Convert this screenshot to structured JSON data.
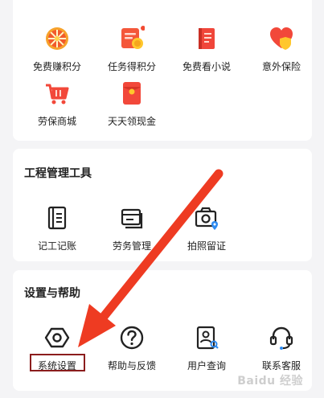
{
  "sections": [
    {
      "title": "",
      "items": [
        {
          "label": "免费赚积分",
          "icon": "wheel-icon"
        },
        {
          "label": "任务得积分",
          "icon": "task-coin-icon"
        },
        {
          "label": "免费看小说",
          "icon": "book-icon"
        },
        {
          "label": "意外保险",
          "icon": "heart-shield-icon"
        },
        {
          "label": "劳保商城",
          "icon": "shopping-basket-icon"
        },
        {
          "label": "天天领现金",
          "icon": "red-envelope-icon"
        }
      ]
    },
    {
      "title": "工程管理工具",
      "items": [
        {
          "label": "记工记账",
          "icon": "ledger-icon"
        },
        {
          "label": "劳务管理",
          "icon": "card-stack-icon"
        },
        {
          "label": "拍照留证",
          "icon": "camera-location-icon"
        }
      ]
    },
    {
      "title": "设置与帮助",
      "items": [
        {
          "label": "系统设置",
          "icon": "hexagon-settings-icon"
        },
        {
          "label": "帮助与反馈",
          "icon": "question-icon"
        },
        {
          "label": "用户查询",
          "icon": "user-search-icon"
        },
        {
          "label": "联系客服",
          "icon": "headset-icon"
        }
      ]
    }
  ],
  "watermark": "Baidu 经验",
  "colors": {
    "accent_red": "#f24a32",
    "arrow_red": "#ee3b22",
    "highlight_border": "#8b1d1d",
    "icon_dark": "#222222"
  }
}
